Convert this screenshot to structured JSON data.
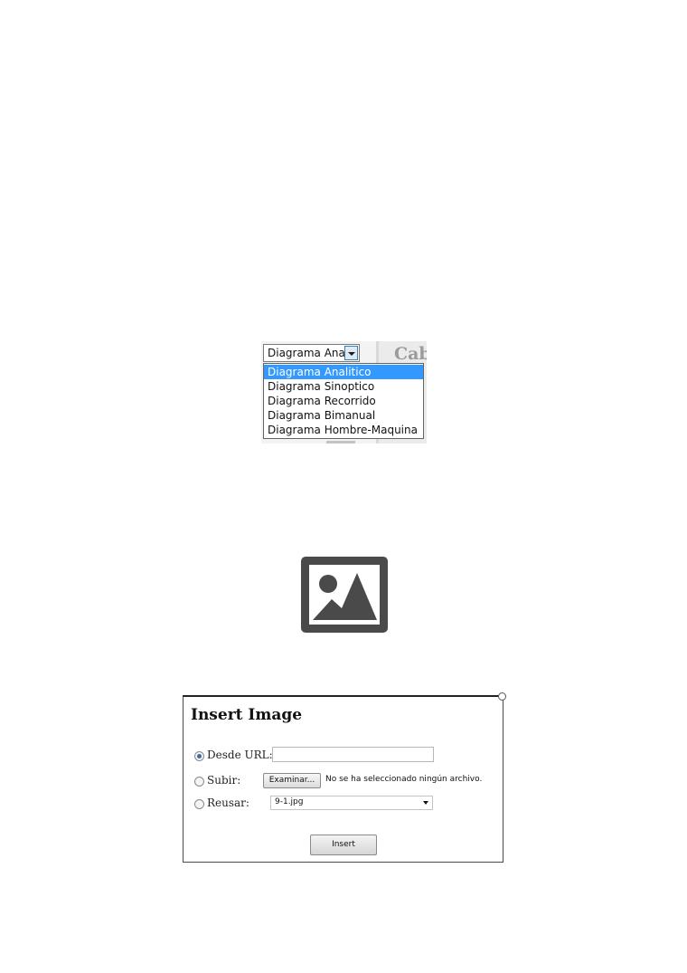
{
  "dropdown_screenshot": {
    "selected_value": "Diagrama Analit",
    "background_heading": "Cab",
    "options": [
      {
        "label": "Diagrama Analitico",
        "selected": true
      },
      {
        "label": "Diagrama Sinoptico",
        "selected": false
      },
      {
        "label": "Diagrama Recorrido",
        "selected": false
      },
      {
        "label": "Diagrama Bimanual",
        "selected": false
      },
      {
        "label": "Diagrama Hombre-Maquina",
        "selected": false
      }
    ],
    "colors": {
      "selected_option_bg": "#3399ff",
      "selected_option_text": "#ffffff"
    }
  },
  "image_placeholder": {
    "icon": "image-placeholder-icon",
    "color": "#4a4a4a"
  },
  "insert_image_dialog": {
    "title": "Insert Image",
    "options": {
      "url": {
        "label": "Desde URL:",
        "checked": true,
        "value": ""
      },
      "upload": {
        "label": "Subir:",
        "checked": false,
        "button_label": "Examinar...",
        "status": "No se ha seleccionado ningún archivo."
      },
      "reuse": {
        "label": "Reusar:",
        "checked": false,
        "selected_value": "9-1.jpg"
      }
    },
    "insert_label": "Insert"
  }
}
